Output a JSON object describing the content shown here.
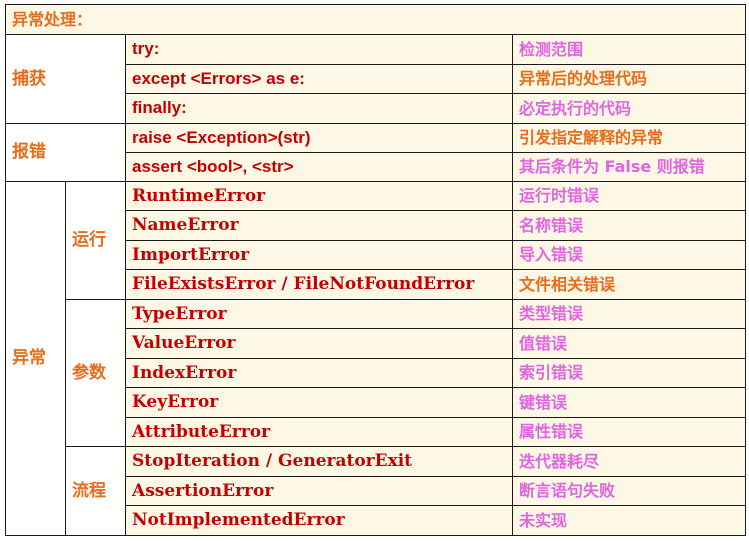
{
  "title": "异常处理：",
  "catch": {
    "label": "捕获",
    "rows": [
      {
        "code": "try:",
        "desc": "检测范围",
        "color": "pink"
      },
      {
        "code": "except <Errors> as e:",
        "desc": "异常后的处理代码",
        "color": "orange"
      },
      {
        "code": "finally:",
        "desc": "必定执行的代码",
        "color": "pink"
      }
    ]
  },
  "report": {
    "label": "报错",
    "rows": [
      {
        "code": "raise <Exception>(str)",
        "desc": "引发指定解释的异常",
        "color": "orange"
      },
      {
        "code": "assert <bool>, <str>",
        "desc": "其后条件为 False 则报错",
        "color": "pink"
      }
    ]
  },
  "exceptions": {
    "label": "异常",
    "groups": [
      {
        "label": "运行",
        "rows": [
          {
            "code": "RuntimeError",
            "desc": "运行时错误",
            "color": "pink"
          },
          {
            "code": "NameError",
            "desc": "名称错误",
            "color": "pink"
          },
          {
            "code": "ImportError",
            "desc": "导入错误",
            "color": "pink"
          },
          {
            "code": "FileExistsError / FileNotFoundError",
            "desc": "文件相关错误",
            "color": "orange"
          }
        ]
      },
      {
        "label": "参数",
        "rows": [
          {
            "code": "TypeError",
            "desc": "类型错误",
            "color": "pink"
          },
          {
            "code": "ValueError",
            "desc": "值错误",
            "color": "pink"
          },
          {
            "code": "IndexError",
            "desc": "索引错误",
            "color": "pink"
          },
          {
            "code": "KeyError",
            "desc": "键错误",
            "color": "pink"
          },
          {
            "code": "AttributeError",
            "desc": "属性错误",
            "color": "pink"
          }
        ]
      },
      {
        "label": "流程",
        "rows": [
          {
            "code": "StopIteration / GeneratorExit",
            "desc": "迭代器耗尽",
            "color": "pink"
          },
          {
            "code": "AssertionError",
            "desc": "断言语句失败",
            "color": "pink"
          },
          {
            "code": "NotImplementedError",
            "desc": "未实现",
            "color": "pink"
          }
        ]
      }
    ]
  },
  "colors": {
    "orange": "#e86c1c",
    "pink": "#e066e0",
    "code": "#c40000",
    "cell_bg": "#fdf7e6",
    "border": "#1a1a1a"
  }
}
